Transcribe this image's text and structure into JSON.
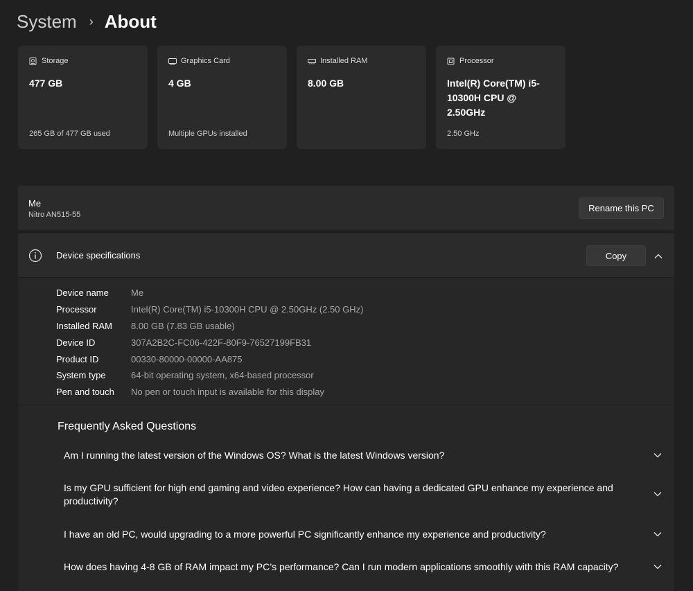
{
  "header": {
    "parent": "System",
    "current": "About"
  },
  "cards": [
    {
      "icon": "storage-icon",
      "label": "Storage",
      "value": "477 GB",
      "sub": "265 GB of 477 GB used"
    },
    {
      "icon": "graphics-card-icon",
      "label": "Graphics Card",
      "value": "4 GB",
      "sub": "Multiple GPUs installed"
    },
    {
      "icon": "ram-icon",
      "label": "Installed RAM",
      "value": "8.00 GB",
      "sub": ""
    },
    {
      "icon": "processor-icon",
      "label": "Processor",
      "value": "Intel(R) Core(TM) i5-10300H CPU @ 2.50GHz",
      "sub": "2.50 GHz"
    }
  ],
  "pc": {
    "name": "Me",
    "model": "Nitro AN515-55",
    "rename_label": "Rename this PC"
  },
  "specs": {
    "title": "Device specifications",
    "copy_label": "Copy",
    "rows": [
      {
        "k": "Device name",
        "v": "Me"
      },
      {
        "k": "Processor",
        "v": "Intel(R) Core(TM) i5-10300H CPU @ 2.50GHz (2.50 GHz)"
      },
      {
        "k": "Installed RAM",
        "v": "8.00 GB (7.83 GB usable)"
      },
      {
        "k": "Device ID",
        "v": "307A2B2C-FC06-422F-80F9-76527199FB31"
      },
      {
        "k": "Product ID",
        "v": "00330-80000-00000-AA875"
      },
      {
        "k": "System type",
        "v": "64-bit operating system, x64-based processor"
      },
      {
        "k": "Pen and touch",
        "v": "No pen or touch input is available for this display"
      }
    ]
  },
  "faq": {
    "title": "Frequently Asked Questions",
    "items": [
      "Am I running the latest version of the Windows OS? What is the latest Windows version?",
      "Is my GPU sufficient for high end gaming and video experience? How can having a dedicated GPU enhance my experience and productivity?",
      "I have an old PC, would upgrading to a more powerful PC significantly enhance my experience and productivity?",
      "How does having 4-8 GB of RAM impact my PC’s performance? Can I run modern applications smoothly with this RAM capacity?"
    ]
  }
}
